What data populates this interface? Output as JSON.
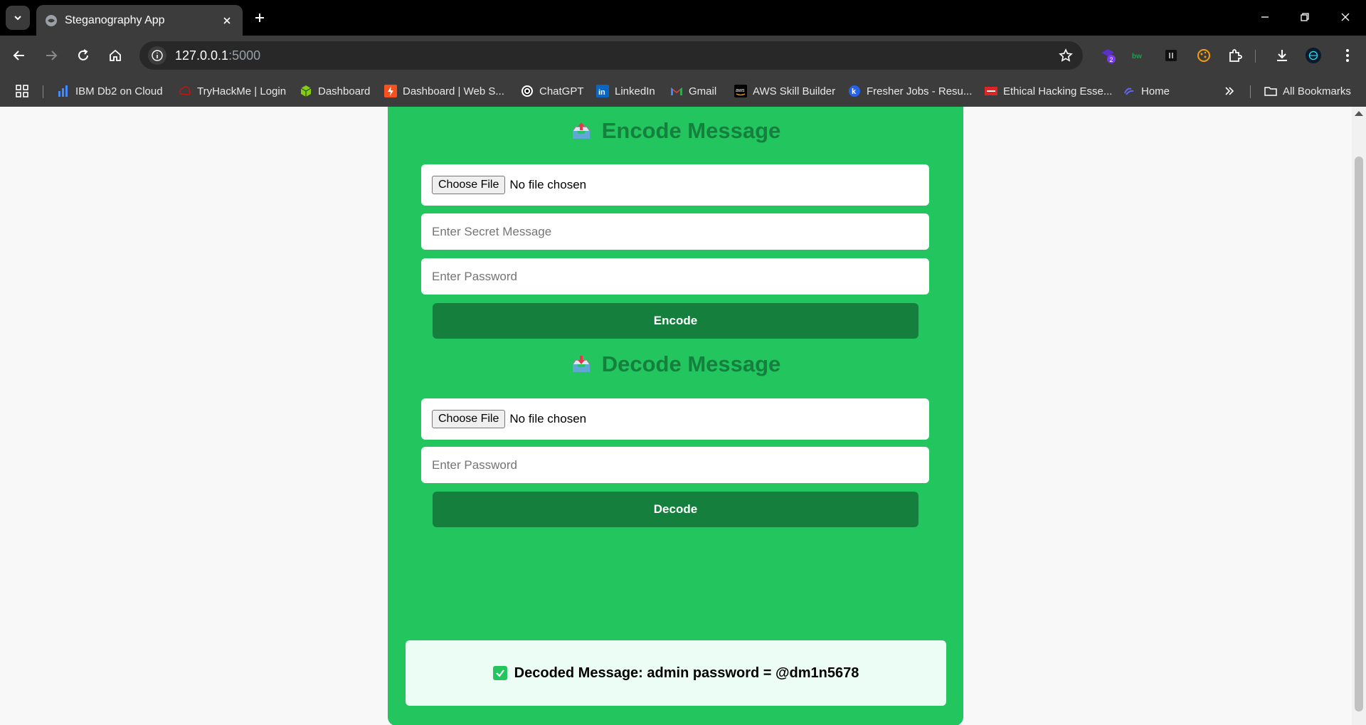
{
  "browser": {
    "tab_title": "Steganography App",
    "url_host": "127.0.0.1",
    "url_port": ":5000",
    "bookmarks": [
      {
        "label": "IBM Db2 on Cloud",
        "icon": "bar-chart-icon"
      },
      {
        "label": "TryHackMe | Login",
        "icon": "tryhackme-icon"
      },
      {
        "label": "Dashboard",
        "icon": "cube-icon"
      },
      {
        "label": "Dashboard | Web S...",
        "icon": "bolt-icon"
      },
      {
        "label": "ChatGPT",
        "icon": "openai-icon"
      },
      {
        "label": "LinkedIn",
        "icon": "linkedin-icon"
      },
      {
        "label": "Gmail",
        "icon": "gmail-icon"
      },
      {
        "label": "AWS Skill Builder",
        "icon": "aws-icon"
      },
      {
        "label": "Fresher Jobs - Resu...",
        "icon": "k-icon"
      },
      {
        "label": "Ethical Hacking Esse...",
        "icon": "ec-council-icon"
      },
      {
        "label": "Home",
        "icon": "swirl-icon"
      }
    ],
    "all_bookmarks_label": "All Bookmarks",
    "extension_badge": "2"
  },
  "encode": {
    "title": "Encode Message",
    "file_button": "Choose File",
    "file_status": "No file chosen",
    "message_placeholder": "Enter Secret Message",
    "password_placeholder": "Enter Password",
    "button_label": "Encode"
  },
  "decode": {
    "title": "Decode Message",
    "file_button": "Choose File",
    "file_status": "No file chosen",
    "password_placeholder": "Enter Password",
    "button_label": "Decode"
  },
  "result": {
    "text": "Decoded Message: admin password = @dm1n5678"
  },
  "colors": {
    "card": "#22c55e",
    "heading": "#15803d",
    "button": "#15803d",
    "result_bg": "#ecfdf5"
  }
}
